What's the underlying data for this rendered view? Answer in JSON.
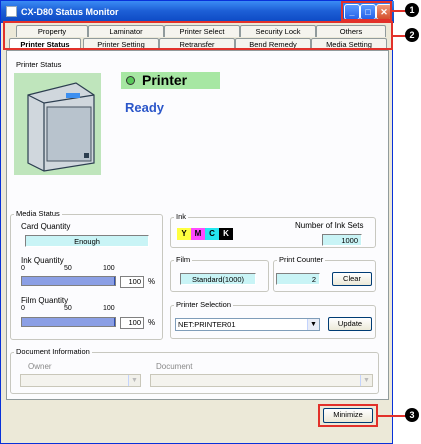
{
  "window": {
    "title": "CX-D80 Status Monitor"
  },
  "tabs": {
    "row1": [
      "Property",
      "Laminator",
      "Printer Select",
      "Security Lock",
      "Others"
    ],
    "row2": [
      "Printer Status",
      "Printer Setting",
      "Retransfer",
      "Bend Remedy",
      "Media Setting"
    ],
    "active": "Printer Status"
  },
  "printer_status": {
    "group_label": "Printer Status",
    "name": "Printer",
    "state": "Ready",
    "indicator_color": "#59c95a"
  },
  "media_status": {
    "group_label": "Media Status",
    "card_quantity_label": "Card Quantity",
    "card_quantity_value": "Enough",
    "ink_quantity_label": "Ink Quantity",
    "ink_scale": [
      "0",
      "50",
      "100"
    ],
    "ink_percent": 100,
    "ink_percent_text": "100",
    "film_quantity_label": "Film Quantity",
    "film_scale": [
      "0",
      "50",
      "100"
    ],
    "film_percent": 100,
    "film_percent_text": "100",
    "percent_unit": "%"
  },
  "ink": {
    "group_label": "Ink",
    "colors": [
      "Y",
      "M",
      "C",
      "K"
    ],
    "number_of_sets_label": "Number of Ink Sets",
    "number_of_sets_value": "1000"
  },
  "film": {
    "group_label": "Film",
    "value": "Standard(1000)"
  },
  "print_counter": {
    "group_label": "Print Counter",
    "value": "2",
    "clear_label": "Clear"
  },
  "printer_selection": {
    "group_label": "Printer Selection",
    "selected": "NET:PRINTER01",
    "update_label": "Update"
  },
  "document_information": {
    "group_label": "Document Information",
    "owner_label": "Owner",
    "document_label": "Document"
  },
  "footer": {
    "minimize_label": "Minimize"
  },
  "callouts": [
    "1",
    "2",
    "3"
  ],
  "colors": {
    "accent": "#e2312a",
    "title_bar": "#1d5fd6",
    "status_green": "#a7e7a3",
    "field_cyan": "#c9f4f6"
  }
}
